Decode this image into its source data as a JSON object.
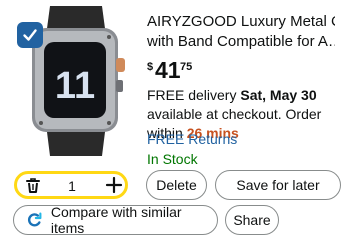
{
  "product": {
    "title_line1": "AIRYZGOOD Luxury Metal Case",
    "title_line2": "with Band Compatible for A…",
    "price": {
      "currency": "$",
      "whole": "41",
      "fraction": "75"
    },
    "delivery": {
      "line1_prefix": "FREE delivery ",
      "line1_date": "Sat, May 30",
      "line2": "available at checkout. Order",
      "line3_prefix": "within ",
      "line3_time": "26 mins"
    },
    "returns": "FREE Returns",
    "stock": "In Stock"
  },
  "quantity": {
    "value": "1"
  },
  "actions": {
    "delete": "Delete",
    "save_for_later": "Save for later",
    "compare": "Compare with similar items",
    "share": "Share"
  },
  "icons": {
    "checkbox": "checkmark-icon",
    "trash": "trash-icon",
    "plus": "plus-icon",
    "compare": "compare-icon"
  },
  "colors": {
    "checkbox": "#2162a1",
    "link": "#2162a1",
    "stock": "#007600",
    "urgency": "#c7511f",
    "quantity_border": "#ffd814"
  }
}
